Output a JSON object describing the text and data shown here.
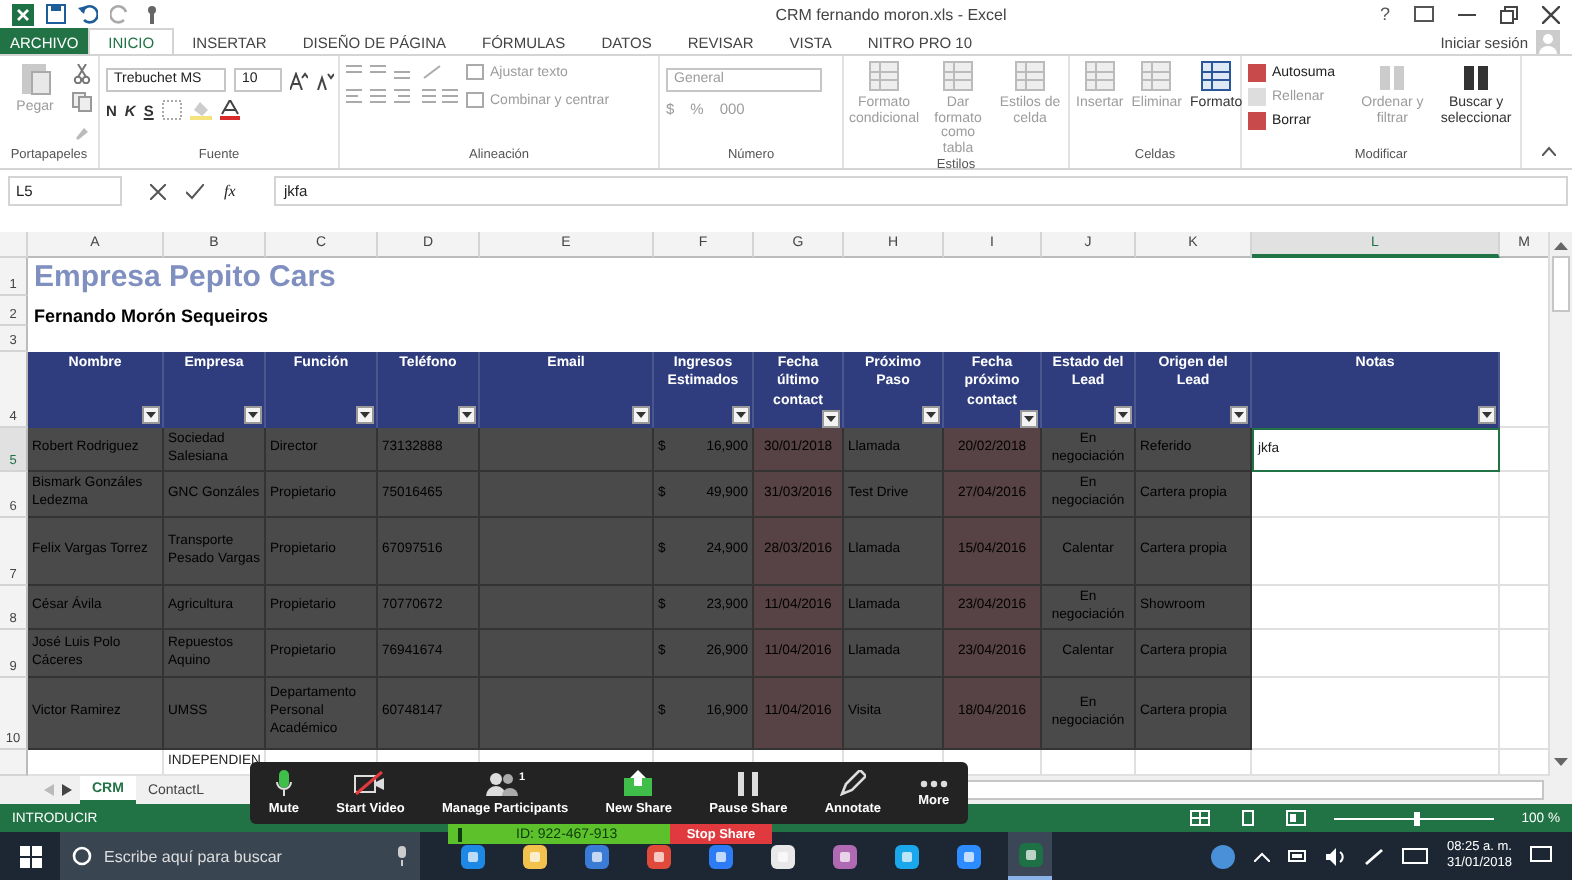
{
  "window": {
    "title": "CRM fernando moron.xls - Excel",
    "help": "?"
  },
  "ribbon_tabs": [
    {
      "label": "ARCHIVO",
      "kind": "file",
      "selected": false
    },
    {
      "label": "INICIO",
      "kind": "tab",
      "selected": true
    },
    {
      "label": "INSERTAR",
      "kind": "tab",
      "selected": false
    },
    {
      "label": "DISEÑO DE PÁGINA",
      "kind": "tab",
      "selected": false
    },
    {
      "label": "FÓRMULAS",
      "kind": "tab",
      "selected": false
    },
    {
      "label": "DATOS",
      "kind": "tab",
      "selected": false
    },
    {
      "label": "REVISAR",
      "kind": "tab",
      "selected": false
    },
    {
      "label": "VISTA",
      "kind": "tab",
      "selected": false
    },
    {
      "label": "NITRO PRO 10",
      "kind": "tab",
      "selected": false
    }
  ],
  "account": {
    "label": "Iniciar sesión"
  },
  "ribbon_groups": [
    {
      "label": "Portapapeles",
      "kind": "clipboard",
      "items": [
        {
          "label": "Pegar",
          "disabled": true
        }
      ]
    },
    {
      "label": "Fuente",
      "kind": "font",
      "font": "Trebuchet MS",
      "size": "10",
      "items": [
        {
          "label": "N",
          "disabled": false
        },
        {
          "label": "K",
          "disabled": false
        },
        {
          "label": "S",
          "disabled": false
        }
      ]
    },
    {
      "label": "Alineación",
      "kind": "alignment",
      "items": [
        {
          "label": "Ajustar texto",
          "disabled": true
        },
        {
          "label": "Combinar y centrar",
          "disabled": true
        }
      ]
    },
    {
      "label": "Número",
      "kind": "number",
      "format": "General",
      "items": [
        {
          "label": "$",
          "disabled": true
        },
        {
          "label": "%",
          "disabled": true
        },
        {
          "label": "000",
          "disabled": true
        }
      ]
    },
    {
      "label": "Estilos",
      "kind": "large",
      "items": [
        {
          "label": "Formato condicional",
          "disabled": true
        },
        {
          "label": "Dar formato como tabla",
          "disabled": true
        },
        {
          "label": "Estilos de celda",
          "disabled": true
        }
      ]
    },
    {
      "label": "Celdas",
      "kind": "large",
      "items": [
        {
          "label": "Insertar",
          "disabled": true
        },
        {
          "label": "Eliminar",
          "disabled": true
        },
        {
          "label": "Formato",
          "disabled": false
        }
      ]
    },
    {
      "label": "Modificar",
      "kind": "editing",
      "items": [
        {
          "label": "Autosuma",
          "kind": "small",
          "disabled": false
        },
        {
          "label": "Rellenar",
          "kind": "small",
          "disabled": true
        },
        {
          "label": "Borrar",
          "kind": "small",
          "disabled": false
        },
        {
          "label": "Ordenar y filtrar",
          "kind": "large",
          "disabled": true
        },
        {
          "label": "Buscar y seleccionar",
          "kind": "large",
          "disabled": false
        }
      ]
    }
  ],
  "formula_bar": {
    "name_box": "L5",
    "function_label": "fx",
    "value": "jkfa"
  },
  "sheet": {
    "columns": [
      {
        "letter": "A",
        "selected": false
      },
      {
        "letter": "B",
        "selected": false
      },
      {
        "letter": "C",
        "selected": false
      },
      {
        "letter": "D",
        "selected": false
      },
      {
        "letter": "E",
        "selected": false
      },
      {
        "letter": "F",
        "selected": false
      },
      {
        "letter": "G",
        "selected": false
      },
      {
        "letter": "H",
        "selected": false
      },
      {
        "letter": "I",
        "selected": false
      },
      {
        "letter": "J",
        "selected": false
      },
      {
        "letter": "K",
        "selected": false
      },
      {
        "letter": "L",
        "selected": true
      },
      {
        "letter": "M",
        "selected": false
      }
    ],
    "title_rows": [
      {
        "num": "1",
        "kind": "title",
        "text": "Empresa Pepito Cars"
      },
      {
        "num": "2",
        "kind": "subtitle",
        "text": "Fernando Morón Sequeiros"
      },
      {
        "num": "3",
        "kind": "blank"
      }
    ],
    "header_row": {
      "num": "4",
      "headers": [
        "Nombre",
        "Empresa",
        "Función",
        "Teléfono",
        "Email",
        "Ingresos Estimados",
        "Fecha último contact",
        "Próximo Paso",
        "Fecha próximo contact",
        "Estado del Lead",
        "Origen del Lead",
        "Notas"
      ]
    },
    "rows": [
      {
        "num": "5",
        "selected": true,
        "shaded": true,
        "name": "Robert Rodriguez",
        "company": "Sociedad Salesiana",
        "role": "Director",
        "phone": "73132888",
        "currency": "$",
        "amount": "16,900",
        "last_contact": "30/01/2018",
        "next_step": "Llamada",
        "next_contact": "20/02/2018",
        "status": "En negociación",
        "origin": "Referido",
        "notes": "jkfa"
      },
      {
        "num": "6",
        "selected": false,
        "shaded": true,
        "name": "Bismark Gonzáles Ledezma",
        "company": "GNC Gonzáles",
        "role": "Propietario",
        "phone": "75016465",
        "currency": "$",
        "amount": "49,900",
        "last_contact": "31/03/2016",
        "next_step": "Test Drive",
        "next_contact": "27/04/2016",
        "status": "En negociación",
        "origin": "Cartera propia"
      },
      {
        "num": "7",
        "selected": false,
        "shaded": true,
        "name": "Felix Vargas Torrez",
        "company": "Transporte Pesado Vargas",
        "role": "Propietario",
        "phone": "67097516",
        "currency": "$",
        "amount": "24,900",
        "last_contact": "28/03/2016",
        "next_step": "Llamada",
        "next_contact": "15/04/2016",
        "status": "Calentar",
        "origin": "Cartera propia"
      },
      {
        "num": "8",
        "selected": false,
        "shaded": true,
        "name": "César Ávila",
        "company": "Agricultura",
        "role": "Propietario",
        "phone": "70770672",
        "currency": "$",
        "amount": "23,900",
        "last_contact": "11/04/2016",
        "next_step": "Llamada",
        "next_contact": "23/04/2016",
        "status": "En negociación",
        "origin": "Showroom"
      },
      {
        "num": "9",
        "selected": false,
        "shaded": true,
        "name": "José Luis Polo Cáceres",
        "company": "Repuestos Aquino",
        "role": "Propietario",
        "phone": "76941674",
        "currency": "$",
        "amount": "26,900",
        "last_contact": "11/04/2016",
        "next_step": "Llamada",
        "next_contact": "23/04/2016",
        "status": "Calentar",
        "origin": "Cartera propia"
      },
      {
        "num": "10",
        "selected": false,
        "shaded": true,
        "name": "Victor Ramirez",
        "company": "UMSS",
        "role": "Departamento Personal Académico",
        "phone": "60748147",
        "currency": "$",
        "amount": "16,900",
        "last_contact": "11/04/2016",
        "next_step": "Visita",
        "next_contact": "18/04/2016",
        "status": "En negociación",
        "origin": "Cartera propia"
      },
      {
        "selected": false,
        "shaded": false,
        "company": "INDEPENDIEN"
      }
    ]
  },
  "sheet_tabs": [
    {
      "label": "CRM",
      "selected": true
    },
    {
      "label": "ContactL",
      "selected": false
    }
  ],
  "status_bar": {
    "mode": "INTRODUCIR",
    "zoom": "100 %",
    "zoom_slider": {
      "level": 0.5
    }
  },
  "meeting_toolbar": {
    "buttons": [
      {
        "label": "Mute",
        "kind": "mic"
      },
      {
        "label": "Start Video",
        "kind": "video"
      },
      {
        "label": "Manage Participants",
        "kind": "participants",
        "badge": "1"
      },
      {
        "label": "New Share",
        "kind": "share"
      },
      {
        "label": "Pause Share",
        "kind": "pause"
      },
      {
        "label": "Annotate",
        "kind": "annotate"
      },
      {
        "label": "More",
        "kind": "more"
      }
    ],
    "meeting_id": "ID: 922-467-913",
    "stop_share": "Stop Share"
  },
  "taskbar": {
    "search_placeholder": "Escribe aquí para buscar",
    "apps": [
      {
        "kind": "edge",
        "selected": false
      },
      {
        "kind": "folder",
        "selected": false
      },
      {
        "kind": "store",
        "selected": false
      },
      {
        "kind": "chrome",
        "selected": false
      },
      {
        "kind": "dropbox",
        "selected": false
      },
      {
        "kind": "mail",
        "selected": false
      },
      {
        "kind": "photos",
        "selected": false
      },
      {
        "kind": "skype",
        "selected": false
      },
      {
        "kind": "camera",
        "selected": false
      },
      {
        "kind": "excel",
        "selected": true
      }
    ],
    "time": "08:25 a. m.",
    "date": "31/01/2018"
  }
}
